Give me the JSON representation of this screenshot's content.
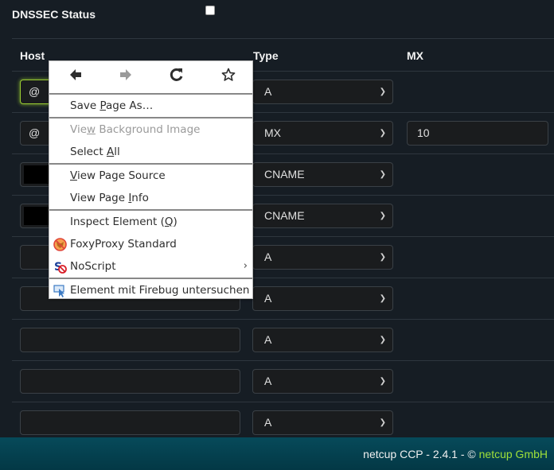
{
  "dnssec": {
    "label": "DNSSEC Status",
    "checked": false
  },
  "table": {
    "headers": {
      "host": "Host",
      "type": "Type",
      "mx": "MX"
    },
    "rows": [
      {
        "host": "@",
        "type": "A",
        "mx": null,
        "focused": true
      },
      {
        "host": "@",
        "type": "MX",
        "mx": "10"
      },
      {
        "host": "",
        "type": "CNAME",
        "mx": null,
        "redacted": true
      },
      {
        "host": "",
        "type": "CNAME",
        "mx": null,
        "redacted": true
      },
      {
        "host": "",
        "type": "A",
        "mx": null
      },
      {
        "host": "",
        "type": "A",
        "mx": null
      },
      {
        "host": "",
        "type": "A",
        "mx": null
      },
      {
        "host": "",
        "type": "A",
        "mx": null
      },
      {
        "host": "",
        "type": "A",
        "mx": null
      }
    ]
  },
  "context_menu": {
    "nav": {
      "back_icon": "arrow-left-icon",
      "forward_icon": "arrow-right-icon",
      "reload_icon": "reload-icon",
      "bookmark_icon": "star-icon"
    },
    "items": {
      "save_page_pre": "Save ",
      "save_page_key": "P",
      "save_page_post": "age As…",
      "view_bg_pre": "Vie",
      "view_bg_key": "w",
      "view_bg_post": " Background Image",
      "select_all_pre": "Select ",
      "select_all_key": "A",
      "select_all_post": "ll",
      "view_source_key": "V",
      "view_source_post": "iew Page Source",
      "view_info_pre": "View Page ",
      "view_info_key": "I",
      "view_info_post": "nfo",
      "inspect_pre": "Inspect Element (",
      "inspect_key": "Q",
      "inspect_post": ")",
      "foxyproxy": "FoxyProxy Standard",
      "noscript": "NoScript",
      "noscript_arrow": "›",
      "firebug": "Element mit Firebug untersuchen"
    }
  },
  "footer": {
    "text": "netcup CCP - 2.4.1 - © ",
    "link": "netcup GmbH",
    "link_color": "#9fe03a"
  }
}
